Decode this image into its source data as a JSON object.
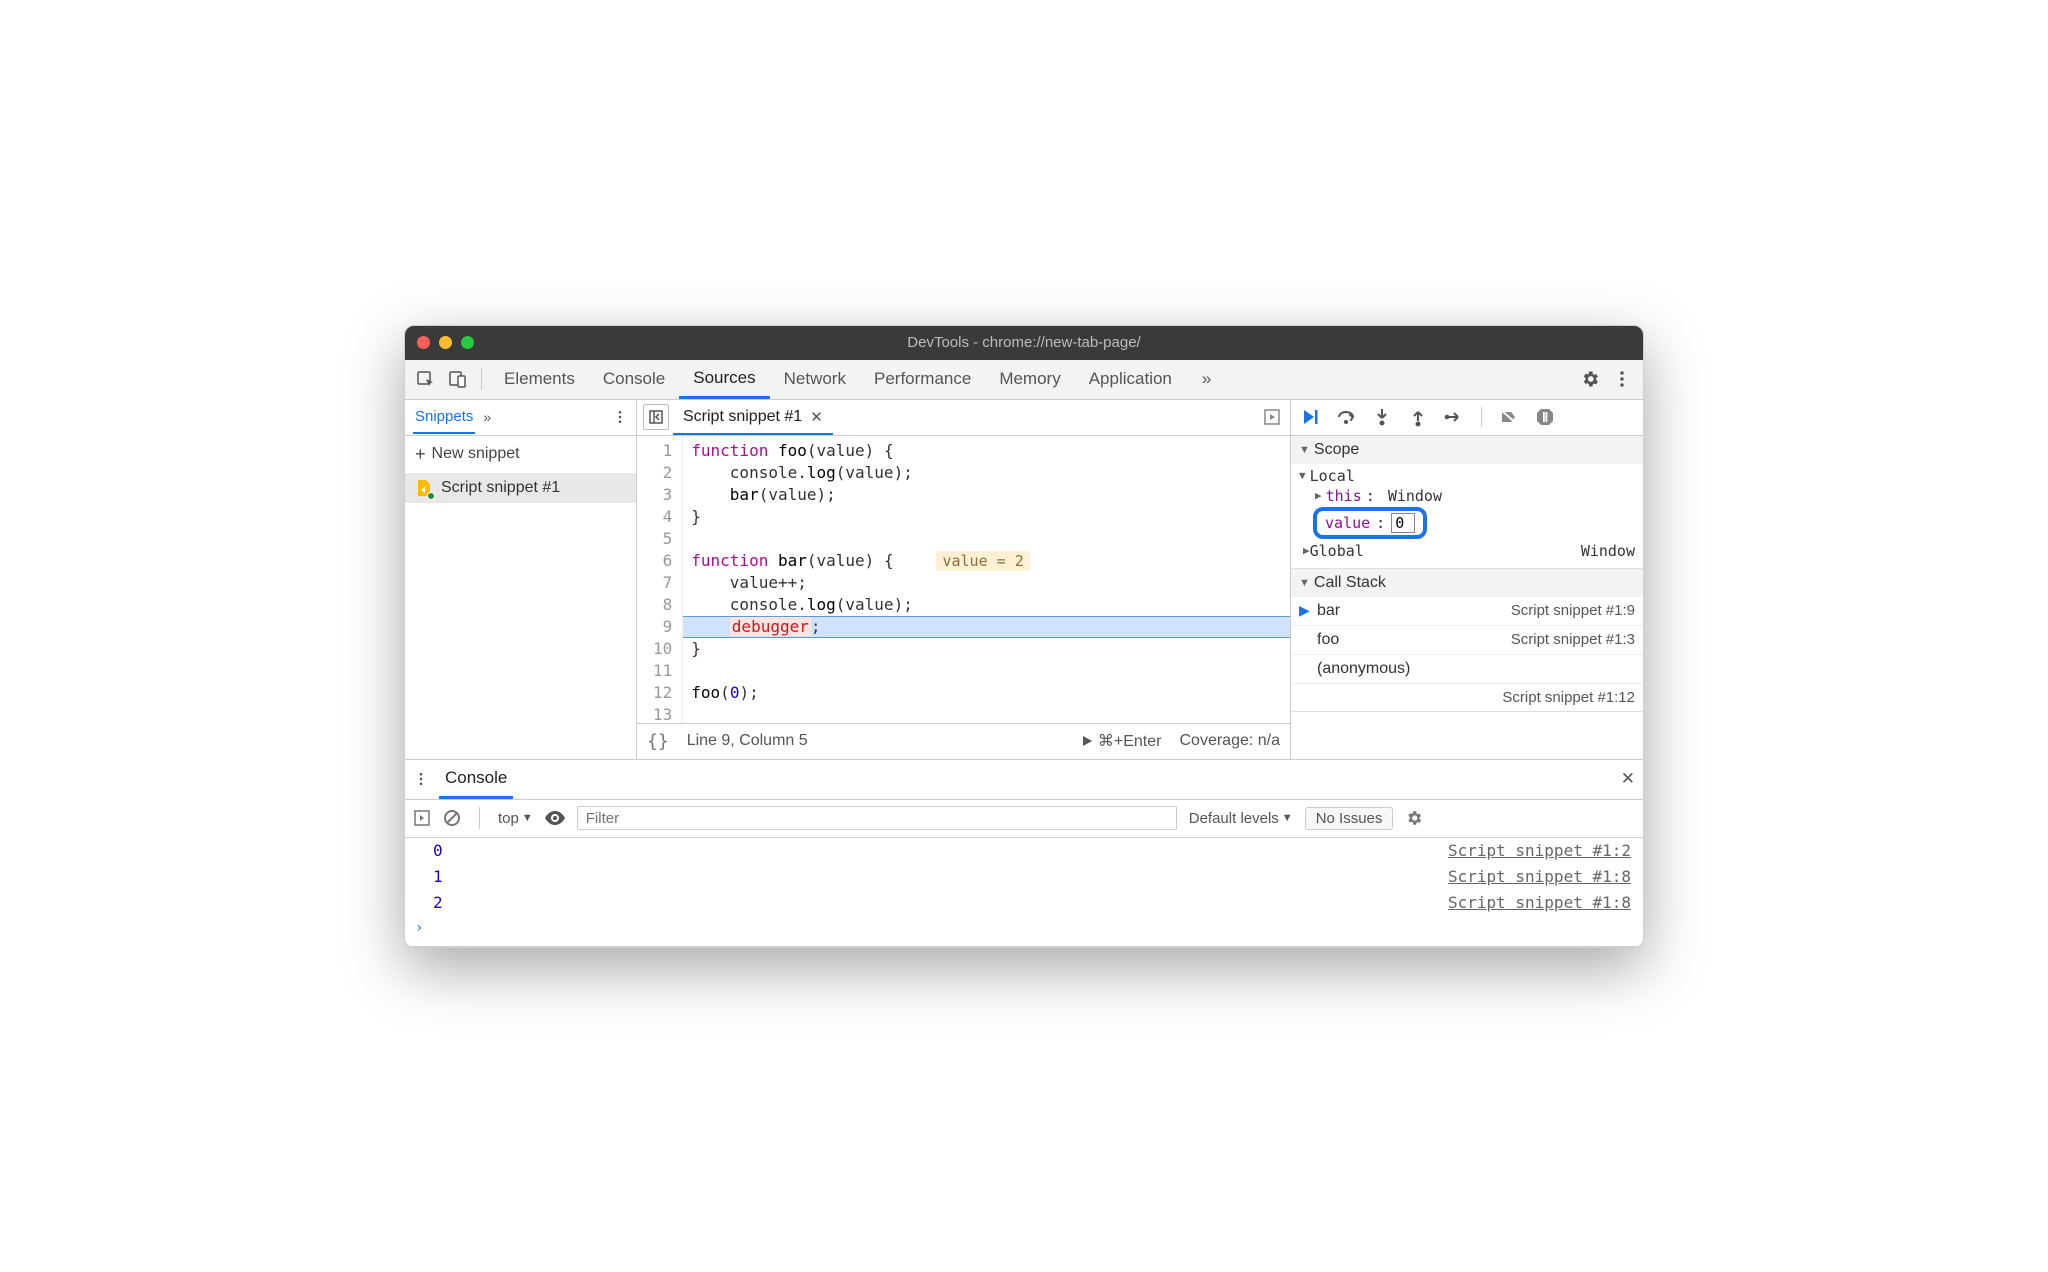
{
  "titlebar": {
    "title": "DevTools - chrome://new-tab-page/"
  },
  "topTabs": {
    "items": [
      "Elements",
      "Console",
      "Sources",
      "Network",
      "Performance",
      "Memory",
      "Application"
    ],
    "activeIndex": 2,
    "more": "»"
  },
  "leftPanel": {
    "activeTab": "Snippets",
    "more": "»",
    "newLabel": "New snippet",
    "plus": "+",
    "snippet": "Script snippet #1"
  },
  "editor": {
    "fileTab": "Script snippet #1",
    "close": "✕",
    "lines": [
      {
        "n": 1,
        "html": "<span class='kw'>function</span> <span class='fn'>foo</span>(value) {"
      },
      {
        "n": 2,
        "html": "    console.<span class='fn'>log</span>(value);"
      },
      {
        "n": 3,
        "html": "    <span class='fn'>bar</span>(value);"
      },
      {
        "n": 4,
        "html": "}"
      },
      {
        "n": 5,
        "html": ""
      },
      {
        "n": 6,
        "html": "<span class='kw'>function</span> <span class='fn'>bar</span>(value) {   <span class='inl'>value = 2</span>"
      },
      {
        "n": 7,
        "html": "    value++;"
      },
      {
        "n": 8,
        "html": "    console.<span class='fn'>log</span>(value);"
      },
      {
        "n": 9,
        "html": "    <span class='dbg'>debugger</span>;",
        "hl": true
      },
      {
        "n": 10,
        "html": "}"
      },
      {
        "n": 11,
        "html": ""
      },
      {
        "n": 12,
        "html": "<span class='fn'>foo</span>(<span class='num'>0</span>);"
      },
      {
        "n": 13,
        "html": ""
      }
    ],
    "status": {
      "braces": "{}",
      "cursor": "Line 9, Column 5",
      "run": "⌘+Enter",
      "coverage": "Coverage: n/a"
    }
  },
  "rightPanel": {
    "scope": {
      "title": "Scope",
      "local": "Local",
      "thisKey": "this",
      "thisVal": "Window",
      "valueKey": "value",
      "valueVal": "0",
      "global": "Global",
      "globalVal": "Window"
    },
    "callStack": {
      "title": "Call Stack",
      "rows": [
        {
          "fn": "bar",
          "loc": "Script snippet #1:9",
          "active": true
        },
        {
          "fn": "foo",
          "loc": "Script snippet #1:3",
          "active": false
        },
        {
          "fn": "(anonymous)",
          "loc": "Script snippet #1:12",
          "active": false,
          "twoLine": true
        }
      ]
    }
  },
  "drawer": {
    "tab": "Console",
    "close": "✕",
    "context": "top",
    "filterPlaceholder": "Filter",
    "levels": "Default levels",
    "noIssues": "No Issues",
    "rows": [
      {
        "v": "0",
        "src": "Script snippet #1:2"
      },
      {
        "v": "1",
        "src": "Script snippet #1:8"
      },
      {
        "v": "2",
        "src": "Script snippet #1:8"
      }
    ],
    "prompt": "›"
  }
}
